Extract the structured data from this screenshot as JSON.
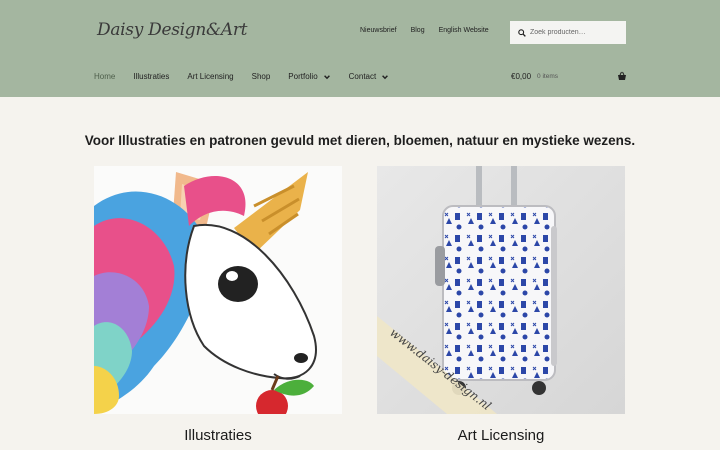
{
  "header": {
    "logo_text": "Daisy Design&Art",
    "secondary_nav": [
      "Nieuwsbrief",
      "Blog",
      "English Website"
    ],
    "search_placeholder": "Zoek producten…",
    "primary_nav": [
      {
        "label": "Home",
        "active": true,
        "dropdown": false
      },
      {
        "label": "Illustraties",
        "active": false,
        "dropdown": false
      },
      {
        "label": "Art Licensing",
        "active": false,
        "dropdown": false
      },
      {
        "label": "Shop",
        "active": false,
        "dropdown": false
      },
      {
        "label": "Portfolio",
        "active": false,
        "dropdown": true
      },
      {
        "label": "Contact",
        "active": false,
        "dropdown": true
      }
    ],
    "cart_amount": "€0,00",
    "cart_count": "0 items"
  },
  "main": {
    "tagline": "Voor Illustraties en patronen gevuld met dieren, bloemen, natuur en mystieke wezens.",
    "cards": [
      {
        "title": "Illustraties",
        "image": "unicorn-illustration"
      },
      {
        "title": "Art Licensing",
        "image": "delft-blue-suitcase",
        "watermark": "www.daisy-design.nl"
      }
    ]
  },
  "colors": {
    "header_bg": "#a4b6a0",
    "page_bg": "#f5f3ee",
    "active_nav": "#4e5f4b"
  }
}
